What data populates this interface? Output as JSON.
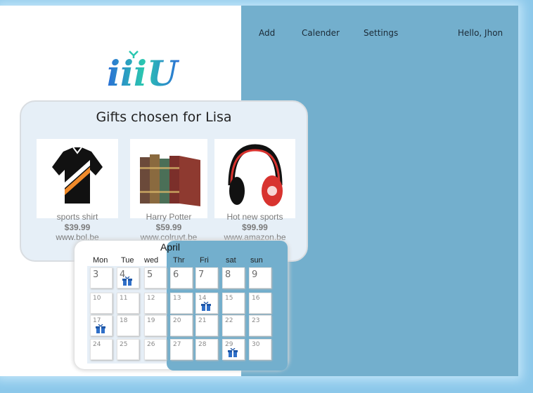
{
  "nav": {
    "items": [
      "Add",
      "Calender",
      "Settings"
    ],
    "greeting": "Hello,  Jhon"
  },
  "logo": {
    "text": "iiiU"
  },
  "gifts": {
    "title": "Gifts chosen for Lisa",
    "items": [
      {
        "name": "sports shirt",
        "price": "$39.99",
        "site": "www.bol.be"
      },
      {
        "name": "Harry Potter",
        "price": "$59.99",
        "site": "www.colruyt.be"
      },
      {
        "name": "Hot new sports",
        "price": "$99.99",
        "site": "www.amazon.be"
      }
    ]
  },
  "calendar": {
    "month": "April",
    "days_of_week": [
      "Mon",
      "Tue",
      "wed",
      "Thr",
      "Fri",
      "sat",
      "sun"
    ],
    "gift_days": [
      4,
      14,
      17,
      29
    ]
  },
  "colors": {
    "panel": "#73afcd",
    "card": "#e6eff7",
    "gift_icon": "#2f6fc8"
  }
}
